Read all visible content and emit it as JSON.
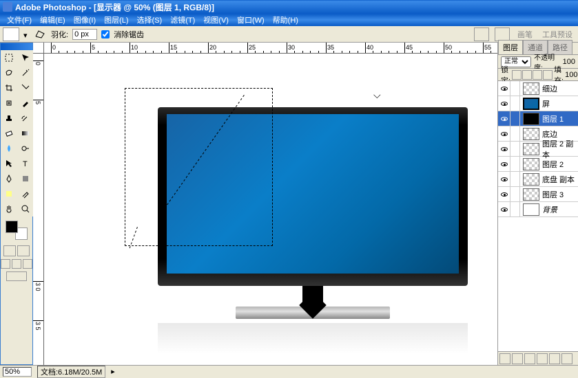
{
  "title": "Adobe Photoshop - [显示器 @ 50% (图层 1, RGB/8)]",
  "menu": [
    "文件(F)",
    "编辑(E)",
    "图像(I)",
    "图层(L)",
    "选择(S)",
    "滤镜(T)",
    "视图(V)",
    "窗口(W)",
    "帮助(H)"
  ],
  "options": {
    "feather_label": "羽化:",
    "feather_value": "0 px",
    "antialias_label": "消除锯齿",
    "brush_label": "画笔",
    "preset_label": "工具预设"
  },
  "ruler_h_labels": [
    {
      "pos": 10,
      "text": "0"
    },
    {
      "pos": 67,
      "text": "5"
    },
    {
      "pos": 124,
      "text": "10"
    },
    {
      "pos": 181,
      "text": "15"
    },
    {
      "pos": 238,
      "text": "20"
    },
    {
      "pos": 295,
      "text": "25"
    },
    {
      "pos": 352,
      "text": "30"
    },
    {
      "pos": 409,
      "text": "35"
    },
    {
      "pos": 466,
      "text": "40"
    },
    {
      "pos": 523,
      "text": "45"
    },
    {
      "pos": 580,
      "text": "50"
    },
    {
      "pos": 637,
      "text": "55"
    }
  ],
  "ruler_v_labels": [
    {
      "pos": 10,
      "text": "0"
    },
    {
      "pos": 67,
      "text": "5"
    },
    {
      "pos": 331,
      "text": "3 0"
    },
    {
      "pos": 388,
      "text": "3 5"
    }
  ],
  "layers_panel": {
    "tabs": [
      "图层",
      "通道",
      "路径"
    ],
    "blend_mode": "正常",
    "opacity_label": "不透明度:",
    "opacity_value": "100",
    "lock_label": "锁定:",
    "fill_label": "填充:",
    "fill_value": "100",
    "layers": [
      {
        "name": "细边",
        "thumb": "thumb-checker",
        "visible": true
      },
      {
        "name": "屏",
        "thumb": "thumb-blue",
        "visible": true
      },
      {
        "name": "图层 1",
        "thumb": "thumb-black",
        "visible": true,
        "selected": true
      },
      {
        "name": "底边",
        "thumb": "thumb-checker",
        "visible": true
      },
      {
        "name": "图层 2 副本",
        "thumb": "thumb-checker",
        "visible": true
      },
      {
        "name": "图层 2",
        "thumb": "thumb-checker",
        "visible": true
      },
      {
        "name": "底盘 副本",
        "thumb": "thumb-checker",
        "visible": true
      },
      {
        "name": "图层 3",
        "thumb": "thumb-checker",
        "visible": true
      },
      {
        "name": "背景",
        "thumb": "thumb-white",
        "visible": true,
        "italic": true
      }
    ]
  },
  "status": {
    "zoom": "50%",
    "docinfo": "文档:6.18M/20.5M"
  },
  "colors": {
    "fg": "#000000",
    "bg": "#ffffff"
  }
}
